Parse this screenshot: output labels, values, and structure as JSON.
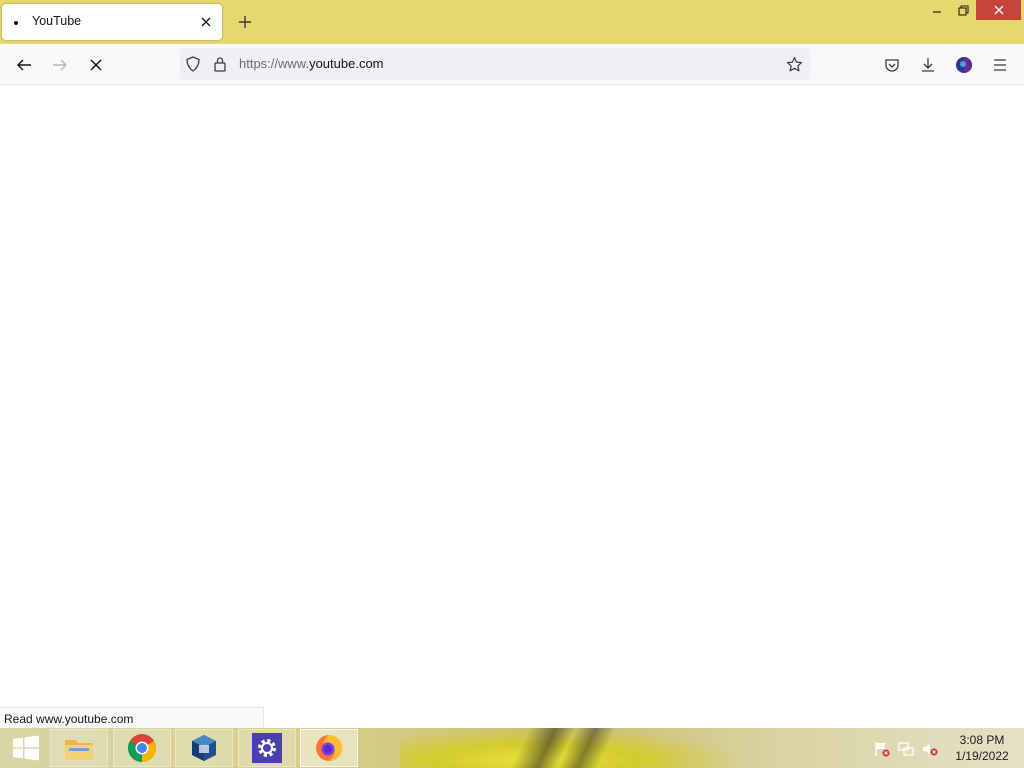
{
  "browser": {
    "tab": {
      "title": "YouTube"
    },
    "url": {
      "prefix": "https://www.",
      "domain": "youtube.com"
    },
    "status_text": "Read www.youtube.com"
  },
  "taskbar": {
    "apps": [
      "file-explorer",
      "chrome",
      "virtualbox",
      "settings",
      "firefox"
    ],
    "clock": {
      "time": "3:08 PM",
      "date": "1/19/2022"
    }
  },
  "colors": {
    "titlebar": "#e3d96c",
    "close_button": "#c7443a",
    "toolbar": "#f9f9fb",
    "urlbar": "#f0f0f4"
  }
}
